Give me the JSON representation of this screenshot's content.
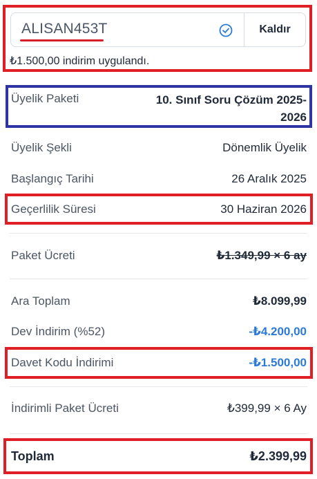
{
  "coupon": {
    "code": "ALISAN453T",
    "remove_label": "Kaldır",
    "applied_message": "₺1.500,00 indirim uygulandı."
  },
  "summary": {
    "package": {
      "label": "Üyelik Paketi",
      "value": "10. Sınıf Soru Çözüm 2025-2026"
    },
    "type": {
      "label": "Üyelik Şekli",
      "value": "Dönemlik Üyelik"
    },
    "start": {
      "label": "Başlangıç Tarihi",
      "value": "26 Aralık 2025"
    },
    "validity": {
      "label": "Geçerlilik Süresi",
      "value": "30 Haziran 2026"
    },
    "package_fee": {
      "label": "Paket Ücreti",
      "value": "₺1.349,99 × 6 ay"
    },
    "subtotal": {
      "label": "Ara Toplam",
      "value": "₺8.099,99"
    },
    "big_discount": {
      "label": "Dev İndirim (%52)",
      "value": "-₺4.200,00"
    },
    "invite_discount": {
      "label": "Davet Kodu İndirimi",
      "value": "-₺1.500,00"
    },
    "discounted_fee": {
      "label": "İndirimli Paket Ücreti",
      "value": "₺399,99 × 6 Ay"
    },
    "total": {
      "label": "Toplam",
      "value": "₺2.399,99"
    }
  },
  "colors": {
    "highlight_red": "#e01e26",
    "highlight_blue": "#2f34a3",
    "discount_blue": "#2b7bd6"
  }
}
